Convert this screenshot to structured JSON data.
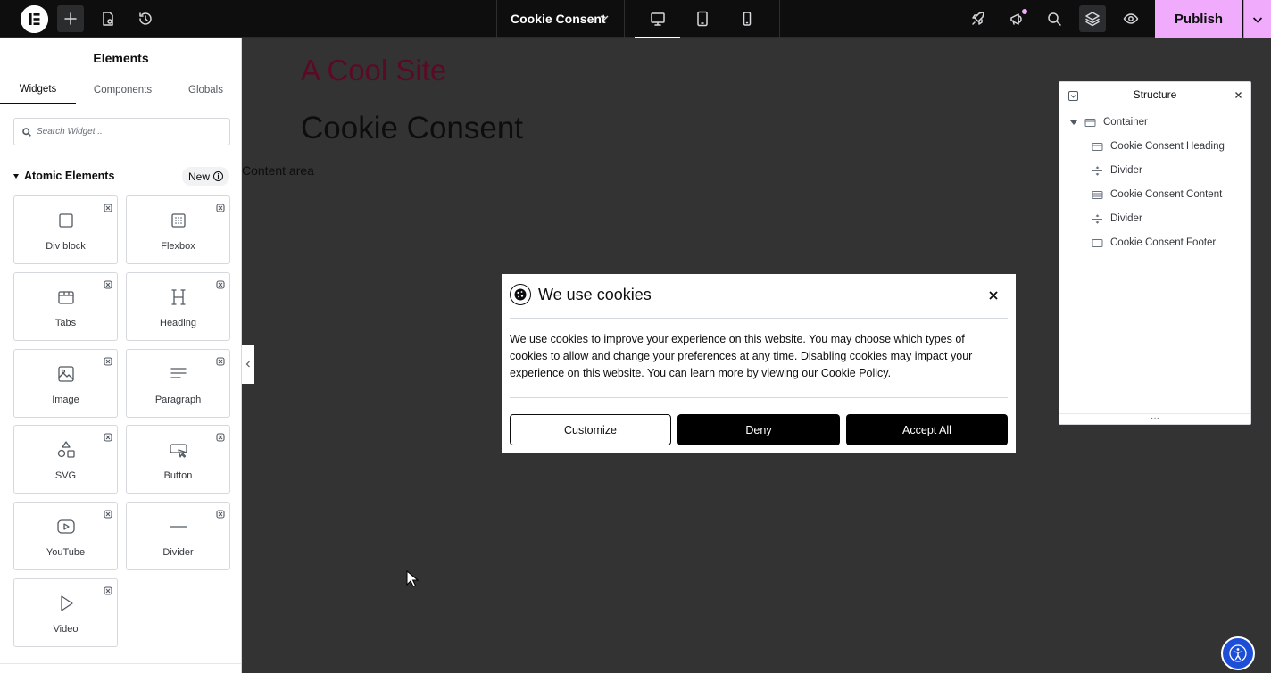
{
  "topbar": {
    "document_title": "Cookie Consent",
    "publish_label": "Publish",
    "accent_color": "#f0abfc"
  },
  "panel": {
    "title": "Elements",
    "tabs": [
      {
        "label": "Widgets",
        "active": true
      },
      {
        "label": "Components",
        "active": false
      },
      {
        "label": "Globals",
        "active": false
      }
    ],
    "search_placeholder": "Search Widget...",
    "category": "Atomic Elements",
    "category_badge": "New",
    "widgets": [
      {
        "label": "Div block",
        "icon": "div-block-icon"
      },
      {
        "label": "Flexbox",
        "icon": "flexbox-icon"
      },
      {
        "label": "Tabs",
        "icon": "tabs-icon"
      },
      {
        "label": "Heading",
        "icon": "heading-icon"
      },
      {
        "label": "Image",
        "icon": "image-icon"
      },
      {
        "label": "Paragraph",
        "icon": "paragraph-icon"
      },
      {
        "label": "SVG",
        "icon": "svg-icon"
      },
      {
        "label": "Button",
        "icon": "button-icon"
      },
      {
        "label": "YouTube",
        "icon": "youtube-icon"
      },
      {
        "label": "Divider",
        "icon": "divider-icon"
      },
      {
        "label": "Video",
        "icon": "video-icon"
      }
    ]
  },
  "canvas": {
    "site_title": "A Cool Site",
    "page_heading": "Cookie Consent",
    "content_area": "Content area",
    "site_title_color": "#5b0a26"
  },
  "modal": {
    "title": "We use cookies",
    "body": "We use cookies to improve your experience on this website. You may choose which types of cookies to allow and change your preferences at any time. Disabling cookies may impact your experience on this website. You can learn more by viewing our Cookie Policy.",
    "buttons": {
      "customize": "Customize",
      "deny": "Deny",
      "accept": "Accept All"
    }
  },
  "structure": {
    "title": "Structure",
    "items": [
      {
        "label": "Container",
        "icon": "container-icon"
      },
      {
        "label": "Cookie Consent Heading",
        "icon": "section-icon"
      },
      {
        "label": "Divider",
        "icon": "divider-icon"
      },
      {
        "label": "Cookie Consent Content",
        "icon": "section-icon"
      },
      {
        "label": "Divider",
        "icon": "divider-icon"
      },
      {
        "label": "Cookie Consent Footer",
        "icon": "section-icon"
      }
    ]
  }
}
